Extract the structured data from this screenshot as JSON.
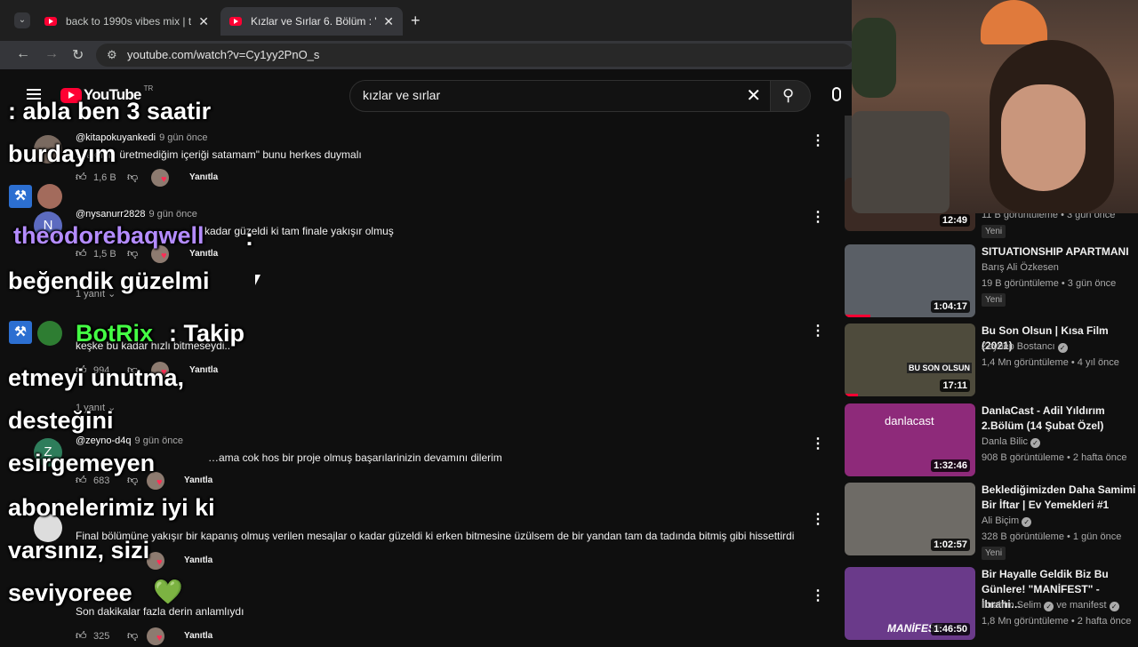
{
  "browser": {
    "tabs": [
      {
        "title": "back to 1990s vibes mix | throw",
        "active": false
      },
      {
        "title": "Kızlar ve Sırlar 6. Bölüm : \"Gerç",
        "active": true
      }
    ],
    "url": "youtube.com/watch?v=Cy1yy2PnO_s",
    "icons": {
      "tab_list": "chevron-down-icon",
      "new_tab": "plus-icon",
      "back": "back-arrow-icon",
      "forward": "forward-arrow-icon",
      "reload": "reload-icon",
      "site_info": "tune-icon"
    }
  },
  "youtube": {
    "logo_text": "YouTube",
    "country_code": "TR",
    "search_value": "kızlar ve sırlar"
  },
  "comments": [
    {
      "author": "@kitapokuyankedi",
      "time": "9 gün önce",
      "text": "…ek için üretmediğim içeriği satamam\" bunu herkes duymalı",
      "likes": "1,6 B",
      "reply": "Yanıtla"
    },
    {
      "author": "@nysanurr2828",
      "time": "9 gün önce",
      "text": "…kadar güzeldi ki tam finale yakışır olmuş",
      "likes": "1,5 B",
      "reply": "Yanıtla",
      "replies_label": "1 yanıt"
    },
    {
      "author": "",
      "time": "",
      "text": "keşke bu kadar hızlı bitmeseydi..",
      "likes": "994",
      "reply": "Yanıtla",
      "replies_label": "1 yanıt"
    },
    {
      "author": "@zeyno-d4q",
      "time": "9 gün önce",
      "text": "…ama cok hos bir proje olmuş başarılarinizin devamını dilerim",
      "likes": "683",
      "reply": "Yanıtla"
    },
    {
      "author": "",
      "time": "",
      "text": "Final bölümüne yakışır bir kapanış olmuş verilen mesajlar o kadar güzeldi ki erken bitmesine üzülsem de bir yandan tam da tadında bitmiş gibi hissettirdi",
      "likes": "",
      "reply": "Yanıtla"
    },
    {
      "author": "",
      "time": "",
      "text": "Son dakikalar fazla derin anlamlıydı",
      "likes": "325",
      "reply": "Yanıtla"
    }
  ],
  "overlay_chat": [
    {
      "text": ": abla ben 3 saatir",
      "color": "#ffffff"
    },
    {
      "text": "burdayım",
      "color": "#ffffff"
    },
    {
      "text": "theodorebaqwell",
      "color": "#b48cff"
    },
    {
      "text": ":",
      "color": "#ffffff"
    },
    {
      "text": "beğendik güzelmi",
      "color": "#ffffff"
    },
    {
      "text": "BotRix",
      "color": "#44ff44"
    },
    {
      "text": ": Takip",
      "color": "#ffffff"
    },
    {
      "text": "etmeyi unutma,",
      "color": "#ffffff"
    },
    {
      "text": "desteğini",
      "color": "#ffffff"
    },
    {
      "text": "esirgemeyen",
      "color": "#ffffff"
    },
    {
      "text": "abonelerimiz iyi ki",
      "color": "#ffffff"
    },
    {
      "text": "varsınız, sizi",
      "color": "#ffffff"
    },
    {
      "text": "seviyoreee",
      "color": "#ffffff"
    },
    {
      "text": "💚",
      "color": "#33dd33"
    }
  ],
  "sidebar": {
    "partial_top": {
      "meta": "11 B görüntüleme • 3 gün önce",
      "badge": "Yeni",
      "duration": "12:49"
    },
    "videos": [
      {
        "title": "SITUATIONSHIP APARTMANI",
        "channel": "Barış Ali Özkesen",
        "verified": false,
        "meta": "19 B görüntüleme • 3 gün önce",
        "badge": "Yeni",
        "duration": "1:04:17",
        "thumb_color": "#5a5f66",
        "progress": 0.2
      },
      {
        "title": "Bu Son Olsun | Kısa Film (2021)",
        "channel": "Zeynep Bostancı",
        "verified": true,
        "meta": "1,4 Mn görüntüleme • 4 yıl önce",
        "badge": "",
        "duration": "17:11",
        "thumb_color": "#4e4b3c",
        "thumb_text": "BU SON OLSUN",
        "progress": 0.1
      },
      {
        "title": "DanlaCast - Adil Yıldırım 2.Bölüm (14 Şubat Özel)",
        "channel": "Danla Bilic",
        "verified": true,
        "meta": "908 B görüntüleme • 2 hafta önce",
        "badge": "",
        "duration": "1:32:46",
        "thumb_color": "#8e2a7a",
        "thumb_text": "danlacast",
        "progress": 0
      },
      {
        "title": "Beklediğimizden Daha Samimi Bir İftar | Ev Yemekleri #1",
        "channel": "Ali Biçim",
        "verified": true,
        "meta": "328 B görüntüleme • 1 gün önce",
        "badge": "Yeni",
        "duration": "1:02:57",
        "thumb_color": "#6e6b66",
        "progress": 0
      },
      {
        "title": "Bir Hayalle Geldik Biz Bu Günlere! \"MANİFEST\" - İbrahi…",
        "channel": "İbrahim Selim",
        "channel2": "ve manifest",
        "verified": true,
        "meta": "1,8 Mn görüntüleme • 2 hafta önce",
        "badge": "",
        "duration": "1:46:50",
        "thumb_color": "#6a3a8a",
        "thumb_text": "MANİFEST",
        "progress": 0
      }
    ]
  },
  "colors": {
    "accent": "#ff0033",
    "background": "#0f0f0f",
    "heart": "#ff2e55"
  }
}
